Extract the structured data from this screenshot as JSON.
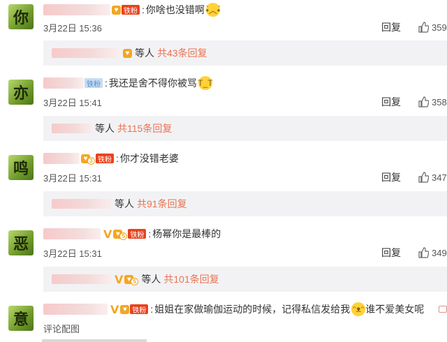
{
  "comments": [
    {
      "avatar_glyph": "你",
      "text": "你啥也没错啊",
      "emoji_icon": "sad-face-emoji",
      "date": "3月22日 15:36",
      "reply_label": "回复",
      "likes": "359",
      "fan_label": "铁粉",
      "reply_summary": {
        "others": "等人",
        "count": "共43条回复"
      }
    },
    {
      "avatar_glyph": "亦",
      "text": "我还是舍不得你被骂",
      "emoji_icon": "crying-face-emoji",
      "date": "3月22日 15:41",
      "reply_label": "回复",
      "likes": "358",
      "fan_label": "铁粉",
      "reply_summary": {
        "others": "等人",
        "count": "共115条回复"
      }
    },
    {
      "avatar_glyph": "鸣",
      "text": "你才没错老婆",
      "date": "3月22日 15:31",
      "reply_label": "回复",
      "likes": "347",
      "fan_label": "铁粉",
      "reply_summary": {
        "others": "等人",
        "count": "共91条回复"
      }
    },
    {
      "avatar_glyph": "恶",
      "text": "杨幂你是最棒的",
      "date": "3月22日 15:31",
      "reply_label": "回复",
      "likes": "349",
      "fan_label": "铁粉",
      "reply_summary": {
        "others": "等人",
        "count": "共101条回复"
      }
    },
    {
      "avatar_glyph": "意",
      "text": "姐姐在家做瑜伽运动的时候，记得私信发给我",
      "text_after": "谁不爱美女呢",
      "emoji_icon": "cat-face-emoji",
      "fan_label": "铁粉",
      "footer_link": "评论配图"
    }
  ],
  "colors": {
    "count_accent": "#eb7350",
    "badge_orange": "#f5a623",
    "reply_bg": "#f2f2f5"
  }
}
